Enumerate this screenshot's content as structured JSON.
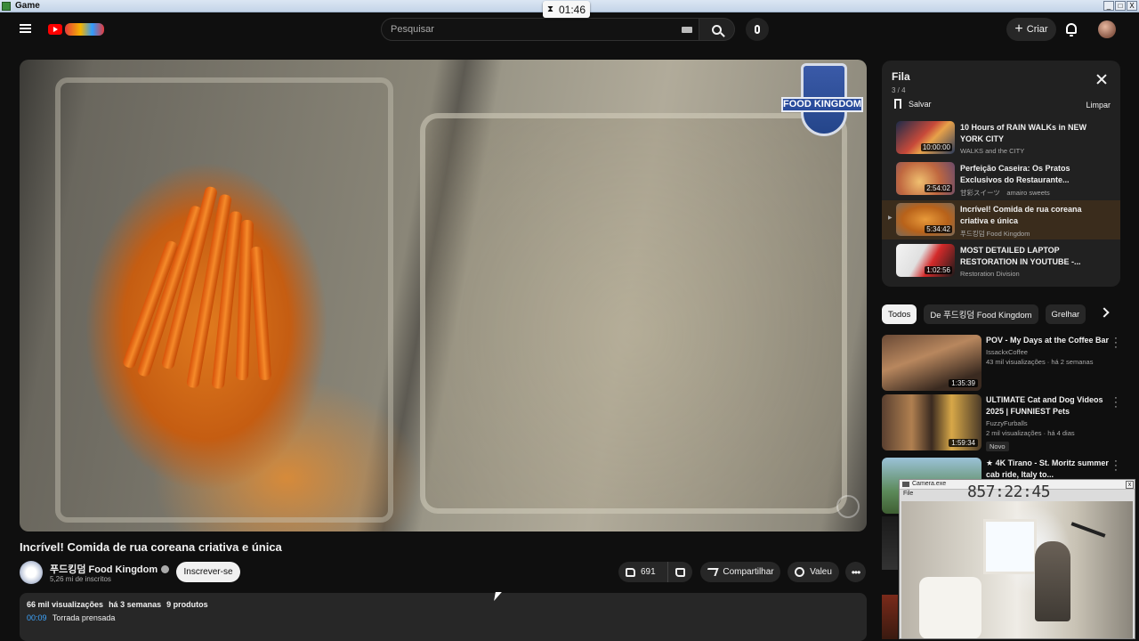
{
  "window": {
    "title": "Game",
    "minimize": "_",
    "maximize": "□",
    "close": "X"
  },
  "timer": {
    "value": "01:46"
  },
  "header": {
    "search_placeholder": "Pesquisar",
    "create_label": "Criar"
  },
  "video": {
    "title": "Incrível! Comida de rua coreana criativa e única",
    "watermark": "FOOD KINGDOM",
    "channel": {
      "name": "푸드킹덤 Food Kingdom",
      "subscribers": "5,26 mi de inscritos",
      "subscribe_label": "Inscrever-se"
    },
    "actions": {
      "likes": "691",
      "share_label": "Compartilhar",
      "thanks_label": "Valeu"
    },
    "description": {
      "views": "66 mil visualizações",
      "age": "há 3 semanas",
      "products": "9 produtos",
      "chapter_time": "00:09",
      "chapter_title": "Torrada prensada"
    }
  },
  "queue": {
    "title": "Fila",
    "position": "3 / 4",
    "save_label": "Salvar",
    "clear_label": "Limpar",
    "items": [
      {
        "title": "10 Hours of RAIN WALKs in NEW YORK CITY",
        "channel": "WALKS and the CITY",
        "duration": "10:00:00"
      },
      {
        "title": "Perfeição Caseira: Os Pratos Exclusivos do Restaurante...",
        "channel": "甘彩スイーツ　amairo sweets",
        "duration": "2:54:02"
      },
      {
        "title": "Incrível! Comida de rua coreana criativa e única",
        "channel": "푸드킹덤 Food Kingdom",
        "duration": "5:34:42"
      },
      {
        "title": "MOST DETAILED LAPTOP RESTORATION IN YOUTUBE -...",
        "channel": "Restoration Division",
        "duration": "1:02:56"
      }
    ]
  },
  "chips": [
    "Todos",
    "De 푸드킹덤 Food Kingdom",
    "Grelhar"
  ],
  "recommendations": [
    {
      "title": "POV - My Days at the Coffee Bar",
      "channel": "IssackxCoffee",
      "meta": "43 mil visualizações · há 2 semanas",
      "duration": "1:35:39",
      "badge": ""
    },
    {
      "title": "ULTIMATE Cat and Dog Videos 2025 | FUNNIEST Pets",
      "channel": "FuzzyFurballs",
      "meta": "2 mil visualizações · há 4 dias",
      "duration": "1:59:34",
      "badge": "Novo"
    },
    {
      "title": "★ 4K Tirano - St. Moritz summer cab ride, Italy to...",
      "channel": "",
      "meta": "",
      "duration": "",
      "badge": ""
    }
  ],
  "webcam": {
    "title": "Camera.exe",
    "menu": "File",
    "counter": "857:22:45"
  },
  "colors": {
    "background": "#0f0f0f",
    "accent": "#ff0000",
    "link": "#3ea6ff"
  }
}
